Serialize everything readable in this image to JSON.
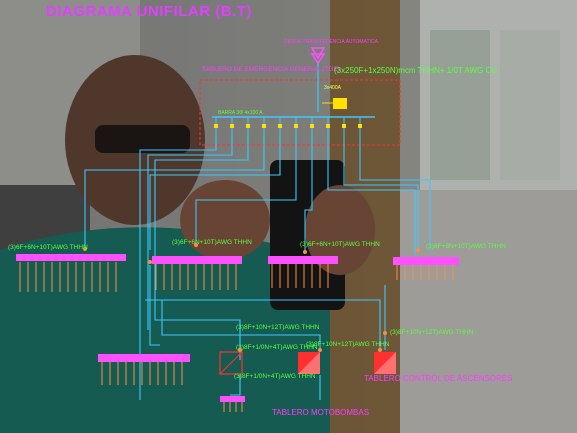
{
  "title": "DIAGRAMA UNIFILAR  (B.T)",
  "source_label": "DESDE TRANSFERENCIA AUTOMATICA",
  "main_board": {
    "label": "TABLERO DE EMERGENCIA GENERAL (TGE)",
    "feed_cable": "(3x250F+1x250N)mcm THHN+ 1/0T AWG CU",
    "bus_label": "BARRA 3Φ 4x100 A",
    "breaker_label": "3x400A"
  },
  "feeders": [
    {
      "cable": "(3)6F+6N+10T)AWG THHN"
    },
    {
      "cable": "(3)6F+6N+10T)AWG THHN"
    },
    {
      "cable": "(3)6F+6N+10T)AWG THHN"
    },
    {
      "cable": "(3)6F+8N+10T)AWG THHN"
    },
    {
      "cable": "(3)8F+10N+12T)AWG THHN"
    },
    {
      "cable": "(3)8F+10N+12T)AWG THHN"
    },
    {
      "cable": "(3)8F+10N+12T)AWG THHN"
    },
    {
      "cable": "(3)8F+1/0N+4T)AWG THHN"
    },
    {
      "cable": "(3)8F+1/0N+4T)AWG THHN"
    }
  ],
  "sub_boards": {
    "ascensores": "TABLERO CONTROL DE ASCENSORES",
    "motobombas": "TABLERO MOTOBOMBAS"
  },
  "colors": {
    "title": "#e040ff",
    "wire": "#3cc8ff",
    "cable_text": "#5cff3c",
    "board_outline": "#ff3030",
    "panel": "#ff50ff"
  }
}
